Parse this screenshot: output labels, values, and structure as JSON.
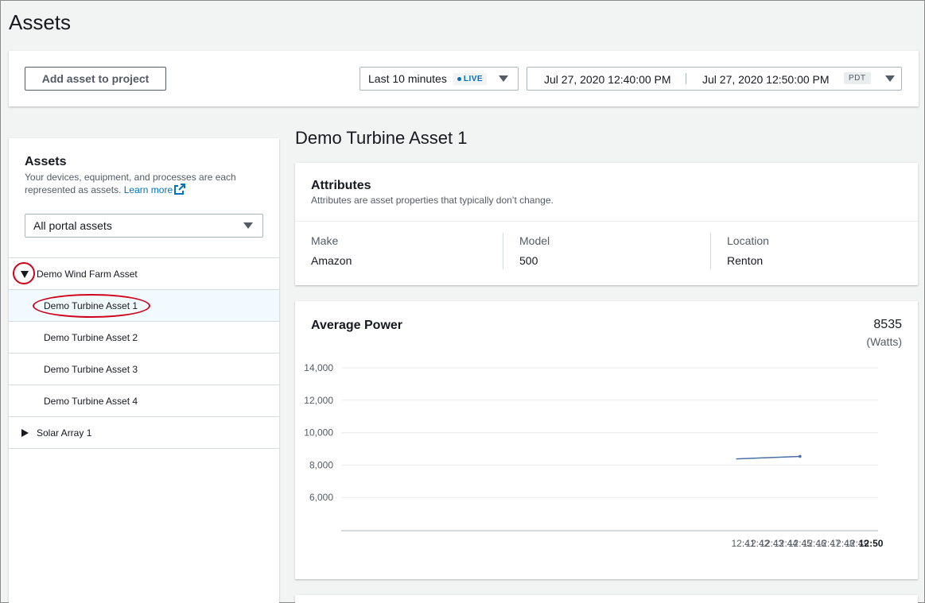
{
  "page": {
    "title": "Assets"
  },
  "toolbar": {
    "add_button": "Add asset to project",
    "range_label": "Last 10 minutes",
    "live_badge": "LIVE",
    "start": "Jul 27, 2020 12:40:00 PM",
    "end": "Jul 27, 2020 12:50:00 PM",
    "timezone": "PDT"
  },
  "sidebar": {
    "title": "Assets",
    "description": "Your devices, equipment, and processes are each represented as assets.",
    "learn_more": "Learn more",
    "filter": "All portal assets",
    "tree": [
      {
        "label": "Demo Wind Farm Asset",
        "expanded": true,
        "annotated": true
      },
      {
        "label": "Demo Turbine Asset 1",
        "selected": true,
        "annotated": true
      },
      {
        "label": "Demo Turbine Asset 2"
      },
      {
        "label": "Demo Turbine Asset 3"
      },
      {
        "label": "Demo Turbine Asset 4"
      },
      {
        "label": "Solar Array 1",
        "expanded": false
      }
    ]
  },
  "main": {
    "asset_title": "Demo Turbine Asset 1",
    "attributes": {
      "title": "Attributes",
      "description": "Attributes are asset properties that typically don’t change.",
      "items": [
        {
          "key": "Make",
          "value": "Amazon"
        },
        {
          "key": "Model",
          "value": "500"
        },
        {
          "key": "Location",
          "value": "Renton"
        }
      ]
    },
    "chart_card": {
      "title": "Average Power",
      "latest_value": "8535",
      "unit": "(Watts)"
    }
  },
  "colors": {
    "accent": "#0073bb",
    "annotation": "#d0021b",
    "line": "#4a6fa5"
  },
  "chart_data": {
    "type": "line",
    "title": "Average Power",
    "xlabel": "",
    "ylabel": "",
    "x_ticks": [
      "12:41",
      "12:42",
      "12:43",
      "12:44",
      "12:45",
      "12:46",
      "12:47",
      "12:48",
      "12:49",
      "12:50"
    ],
    "y_ticks": [
      "14,000",
      "12,000",
      "10,000",
      "8,000",
      "6,000"
    ],
    "y_tick_values": [
      14000,
      12000,
      10000,
      8000,
      6000
    ],
    "xlim": [
      12.667,
      50.5
    ],
    "ylim": [
      4000,
      14000
    ],
    "grid": true,
    "series": [
      {
        "x": [
          40.5,
          45.0
        ],
        "y": [
          8380,
          8535
        ]
      }
    ]
  }
}
